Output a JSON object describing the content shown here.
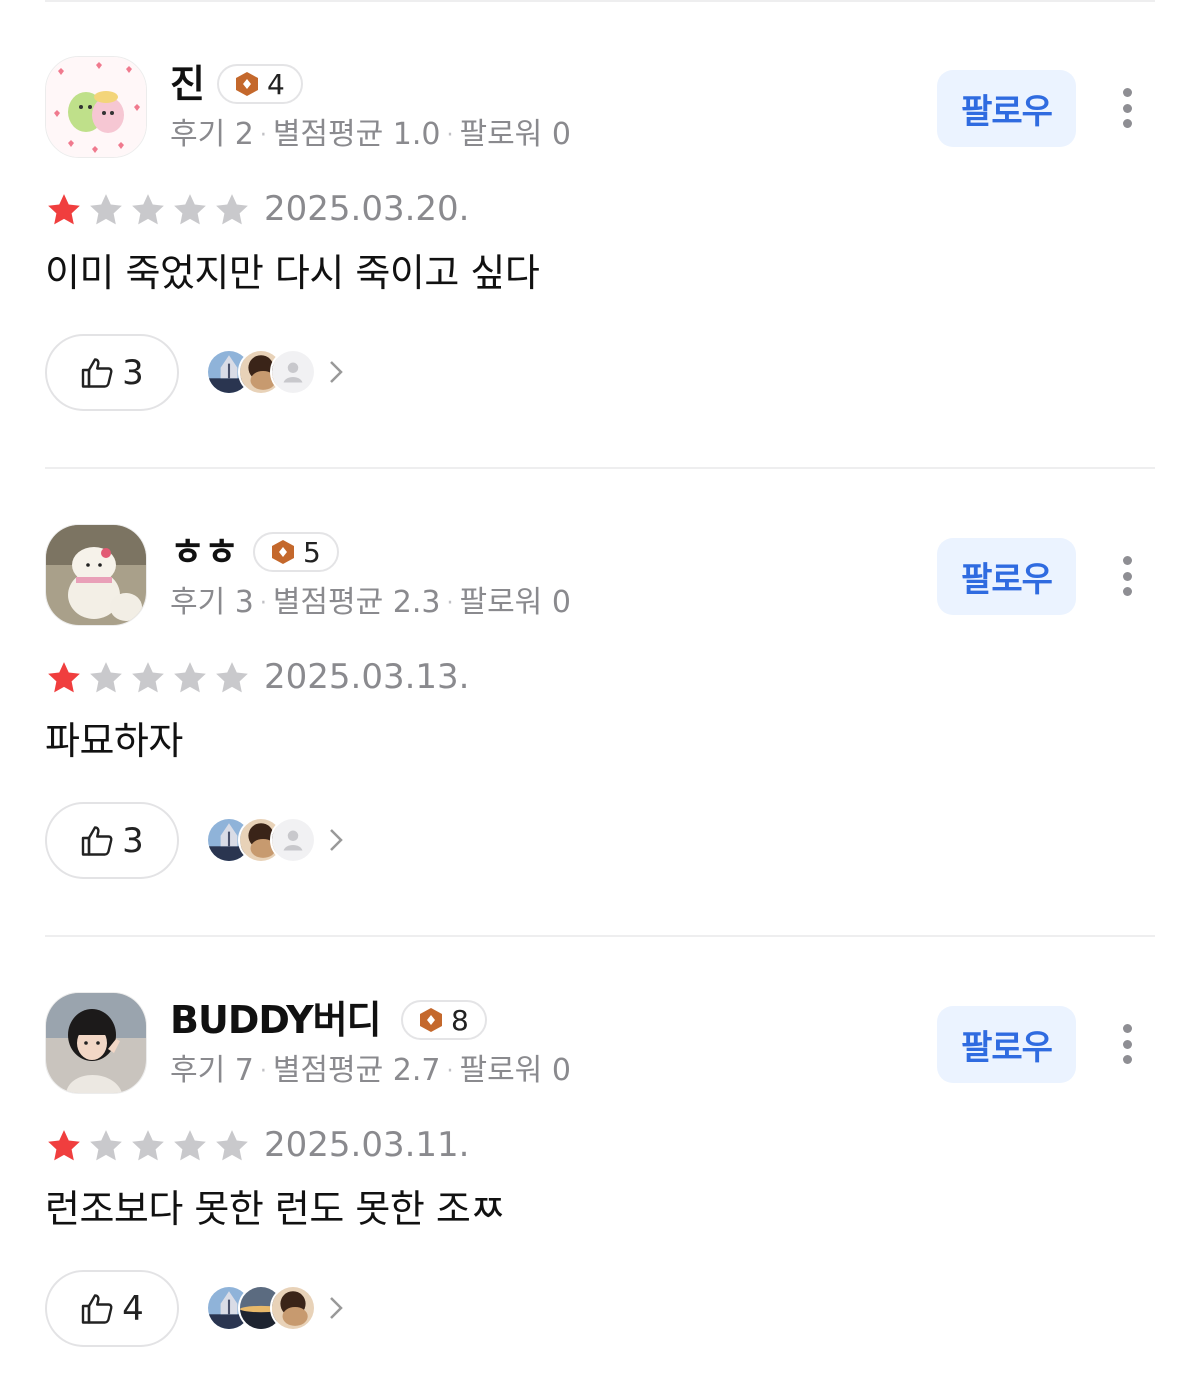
{
  "follow_label": "팔로우",
  "reviews": [
    {
      "name": "진",
      "level": "4",
      "meta": {
        "reviews": "후기 2",
        "avg": "별점평균 1.0",
        "followers": "팔로워 0"
      },
      "rating": 1,
      "date": "2025.03.20.",
      "text": "이미 죽었지만 다시 죽이고 싶다",
      "likes": "3"
    },
    {
      "name": "ㅎㅎ",
      "level": "5",
      "meta": {
        "reviews": "후기 3",
        "avg": "별점평균 2.3",
        "followers": "팔로워 0"
      },
      "rating": 1,
      "date": "2025.03.13.",
      "text": "파묘하자",
      "likes": "3"
    },
    {
      "name": "BUDDY버디",
      "level": "8",
      "meta": {
        "reviews": "후기 7",
        "avg": "별점평균 2.7",
        "followers": "팔로워 0"
      },
      "rating": 1,
      "date": "2025.03.11.",
      "text": "런조보다 못한 런도 못한 조ㅉ",
      "likes": "4"
    }
  ],
  "colors": {
    "star_on": "#f03e3e",
    "star_off": "#c9c9cc",
    "follow_bg": "#ebf3ff",
    "follow_text": "#2f6be0",
    "level_badge": "#c4682c"
  }
}
